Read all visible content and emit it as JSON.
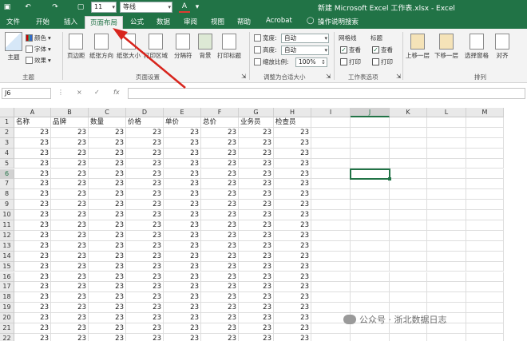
{
  "app": {
    "window_title": "新建 Microsoft Excel 工作表.xlsx  -  Excel",
    "accent": "#217346"
  },
  "qat": {
    "font_name": "等线",
    "font_size": "11",
    "font_color_glyph": "A"
  },
  "tabs": [
    "文件",
    "开始",
    "插入",
    "页面布局",
    "公式",
    "数据",
    "审阅",
    "视图",
    "帮助",
    "Acrobat",
    "操作说明搜索"
  ],
  "active_tab": "页面布局",
  "ribbon": {
    "themes": {
      "big": "主题",
      "colors": "颜色",
      "fonts": "字体",
      "effects": "效果",
      "group": "主题"
    },
    "page_setup": {
      "buttons": [
        "页边距",
        "纸张方向",
        "纸张大小",
        "打印区域",
        "分隔符",
        "背景",
        "打印标题"
      ],
      "group": "页面设置"
    },
    "scale": {
      "width_label": "宽度:",
      "width_value": "自动",
      "height_label": "高度:",
      "height_value": "自动",
      "scale_label": "缩放比例:",
      "scale_value": "100%",
      "group": "调整为合适大小"
    },
    "sheet_options": {
      "gridlines": "网格线",
      "headings": "标题",
      "view": "查看",
      "print": "打印",
      "group": "工作表选项"
    },
    "arrange": {
      "buttons": [
        "上移一层",
        "下移一层",
        "选择窗格",
        "对齐"
      ],
      "group": "排列"
    }
  },
  "formula_bar": {
    "name_box": "J6",
    "cancel": "×",
    "enter": "✓",
    "fx": "fx",
    "formula": ""
  },
  "grid": {
    "columns": [
      "A",
      "B",
      "C",
      "D",
      "E",
      "F",
      "G",
      "H",
      "I",
      "J",
      "K",
      "L",
      "M"
    ],
    "selected_column": "J",
    "selected_row": "6",
    "header_row": [
      "名称",
      "品牌",
      "数量",
      "价格",
      "单价",
      "总价",
      "业务员",
      "检查员"
    ],
    "fill_value": "23",
    "rows": [
      "1",
      "2",
      "3",
      "4",
      "5",
      "6",
      "7",
      "8",
      "9",
      "10",
      "11",
      "12",
      "13",
      "14",
      "15",
      "16",
      "17",
      "18",
      "19",
      "20",
      "21",
      "22"
    ]
  },
  "watermark": {
    "text": "公众号 · 浙北数据日志"
  }
}
